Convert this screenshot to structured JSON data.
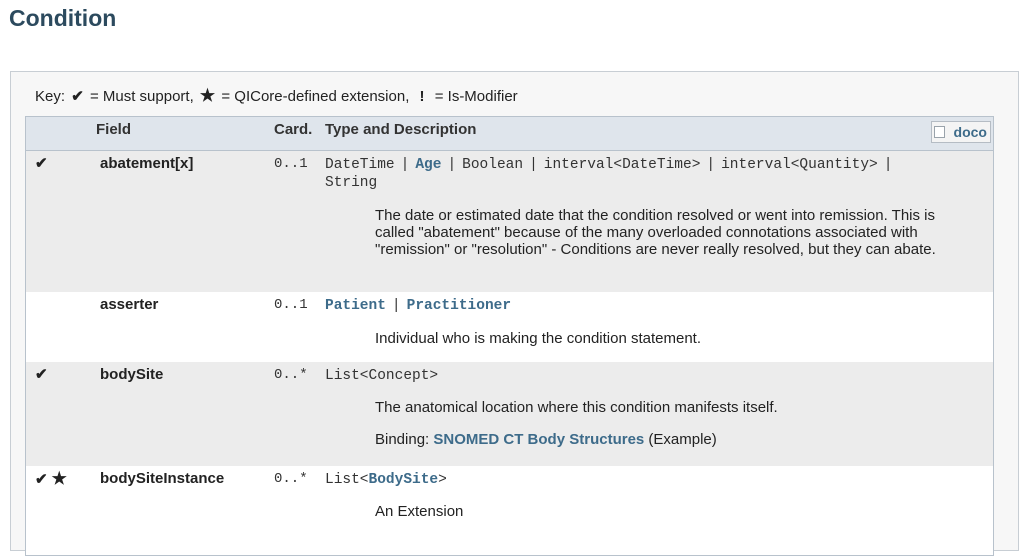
{
  "page": {
    "title": "Condition"
  },
  "key": {
    "label": "Key:",
    "must_support_symbol": "✔",
    "must_support_text": "= Must support,",
    "extension_symbol": "★",
    "extension_text": "= QICore-defined extension,",
    "modifier_symbol": "!",
    "modifier_text": "= Is-Modifier"
  },
  "table": {
    "headers": {
      "field": "Field",
      "card": "Card.",
      "type": "Type and Description"
    },
    "doco_alt": "doco",
    "rows": [
      {
        "flags": "✔",
        "field": "abatement[x]",
        "card": "0..1",
        "types": [
          "DateTime",
          "Age",
          "Boolean",
          "interval<DateTime>",
          "interval<Quantity>",
          "String"
        ],
        "description": "The date or estimated date that the condition resolved or went into remission. This is called \"abatement\" because of the many overloaded connotations associated with \"remission\" or \"resolution\" - Conditions are never really resolved, but they can abate."
      },
      {
        "flags": "",
        "field": "asserter",
        "card": "0..1",
        "types": [
          "Patient",
          "Practitioner"
        ],
        "description": "Individual who is making the condition statement."
      },
      {
        "flags": "✔",
        "field": "bodySite",
        "card": "0..*",
        "type_prefix": "List<Concept>",
        "description": "The anatomical location where this condition manifests itself.",
        "binding_label": "Binding:",
        "binding_link": "SNOMED CT Body Structures",
        "binding_strength": "(Example)"
      },
      {
        "flags": "✔",
        "flag_star": "★",
        "field": "bodySiteInstance",
        "card": "0..*",
        "type_open": "List<",
        "type_link": "BodySite",
        "type_close": ">",
        "description": "An Extension"
      }
    ]
  }
}
